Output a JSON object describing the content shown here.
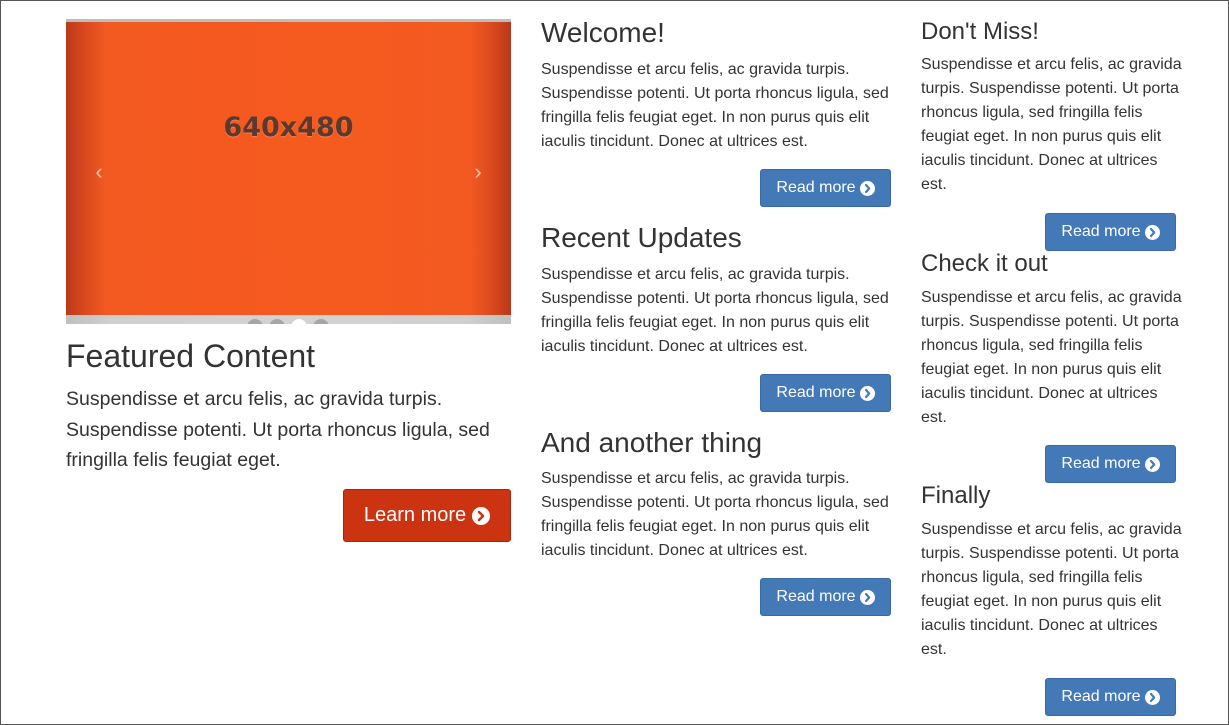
{
  "carousel": {
    "slide_label": "640x480",
    "prev_glyph": "‹",
    "next_glyph": "›",
    "dots": 4,
    "active_dot": 3
  },
  "featured": {
    "title": "Featured Content",
    "text": "Suspendisse et arcu felis, ac gravida turpis. Suspendisse potenti. Ut porta rhoncus ligula, sed fringilla felis feugiat eget.",
    "button_label": "Learn more",
    "button_color": "#cc3311"
  },
  "middle": [
    {
      "title": "Welcome!",
      "text": "Suspendisse et arcu felis, ac gravida turpis. Suspendisse potenti. Ut porta rhoncus ligula, sed fringilla felis feugiat eget. In non purus quis elit iaculis tincidunt. Donec at ultrices est.",
      "button": "Read more"
    },
    {
      "title": "Recent Updates",
      "text": "Suspendisse et arcu felis, ac gravida turpis. Suspendisse potenti. Ut porta rhoncus ligula, sed fringilla felis feugiat eget. In non purus quis elit iaculis tincidunt. Donec at ultrices est.",
      "button": "Read more"
    },
    {
      "title": "And another thing",
      "text": "Suspendisse et arcu felis, ac gravida turpis. Suspendisse potenti. Ut porta rhoncus ligula, sed fringilla felis feugiat eget. In non purus quis elit iaculis tincidunt. Donec at ultrices est.",
      "button": "Read more"
    }
  ],
  "right": [
    {
      "title": "Don't Miss!",
      "text": "Suspendisse et arcu felis, ac gravida turpis. Suspendisse potenti. Ut porta rhoncus ligula, sed fringilla felis feugiat eget. In non purus quis elit iaculis tincidunt. Donec at ultrices est.",
      "button": "Read more"
    },
    {
      "title": "Check it out",
      "text": "Suspendisse et arcu felis, ac gravida turpis. Suspendisse potenti. Ut porta rhoncus ligula, sed fringilla felis feugiat eget. In non purus quis elit iaculis tincidunt. Donec at ultrices est.",
      "button": "Read more"
    },
    {
      "title": "Finally",
      "text": "Suspendisse et arcu felis, ac gravida turpis. Suspendisse potenti. Ut porta rhoncus ligula, sed fringilla felis feugiat eget. In non purus quis elit iaculis tincidunt. Donec at ultrices est.",
      "button": "Read more"
    }
  ],
  "colors": {
    "read_more_button": "#4479b8",
    "slide_orange": "#f5591f"
  },
  "icons": {
    "button_icon": "circle-arrow-right-icon"
  }
}
